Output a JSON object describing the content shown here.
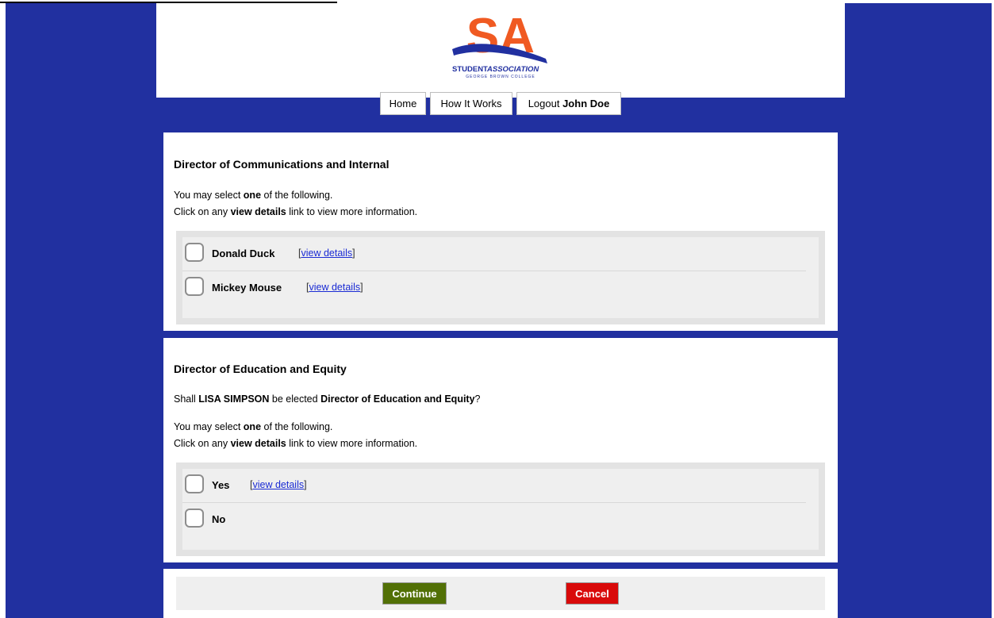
{
  "logo": {
    "big_text": "SA",
    "line1_a": "STUDENT",
    "line1_b": "ASSOCIATION",
    "line2": "GEORGE BROWN COLLEGE",
    "colors": {
      "orange": "#f05a22",
      "blue": "#2130a0"
    }
  },
  "nav": {
    "home": "Home",
    "how_it_works": "How It Works",
    "logout_prefix": "Logout",
    "user_name": "John Doe"
  },
  "sections": [
    {
      "title": "Director of Communications and Internal",
      "instruction": {
        "pre": "You may select",
        "bold": "one",
        "post": "of the following."
      },
      "hint": {
        "pre": "Click on any",
        "bold": "view details",
        "post": "link to view more information."
      },
      "options": [
        {
          "label": "Donald Duck",
          "link": "view details"
        },
        {
          "label": "Mickey Mouse",
          "link": "view details"
        }
      ]
    },
    {
      "title": "Director of Education and Equity",
      "question": {
        "pre": "Shall",
        "candidate": "LISA SIMPSON",
        "mid": "be elected",
        "position": "Director of Education and Equity",
        "post": "?"
      },
      "instruction": {
        "pre": "You may select",
        "bold": "one",
        "post": "of the following."
      },
      "hint": {
        "pre": "Click on any",
        "bold": "view details",
        "post": "link to view more information."
      },
      "options": [
        {
          "label": "Yes",
          "link": "view details"
        },
        {
          "label": "No"
        }
      ]
    }
  ],
  "buttons": {
    "continue": "Continue",
    "cancel": "Cancel"
  },
  "colors": {
    "frame": "#2130a0",
    "continue": "#527006",
    "cancel": "#d90a0a",
    "link": "#1a2bd4"
  }
}
